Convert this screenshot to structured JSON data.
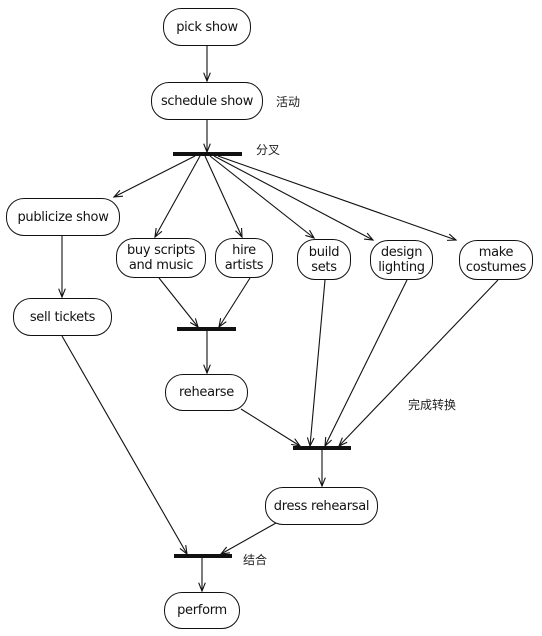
{
  "nodes": {
    "pick_show": "pick show",
    "schedule_show": "schedule show",
    "publicize_show": "publicize show",
    "buy_scripts": "buy scripts and music",
    "hire_artists": "hire artists",
    "build_sets": "build sets",
    "design_lighting": "design lighting",
    "make_costumes": "make costumes",
    "sell_tickets": "sell tickets",
    "rehearse": "rehearse",
    "dress_rehearsal": "dress rehearsal",
    "perform": "perform"
  },
  "annotations": {
    "activity": "活动",
    "fork": "分叉",
    "complete_transition": "完成转换",
    "join": "结合"
  }
}
